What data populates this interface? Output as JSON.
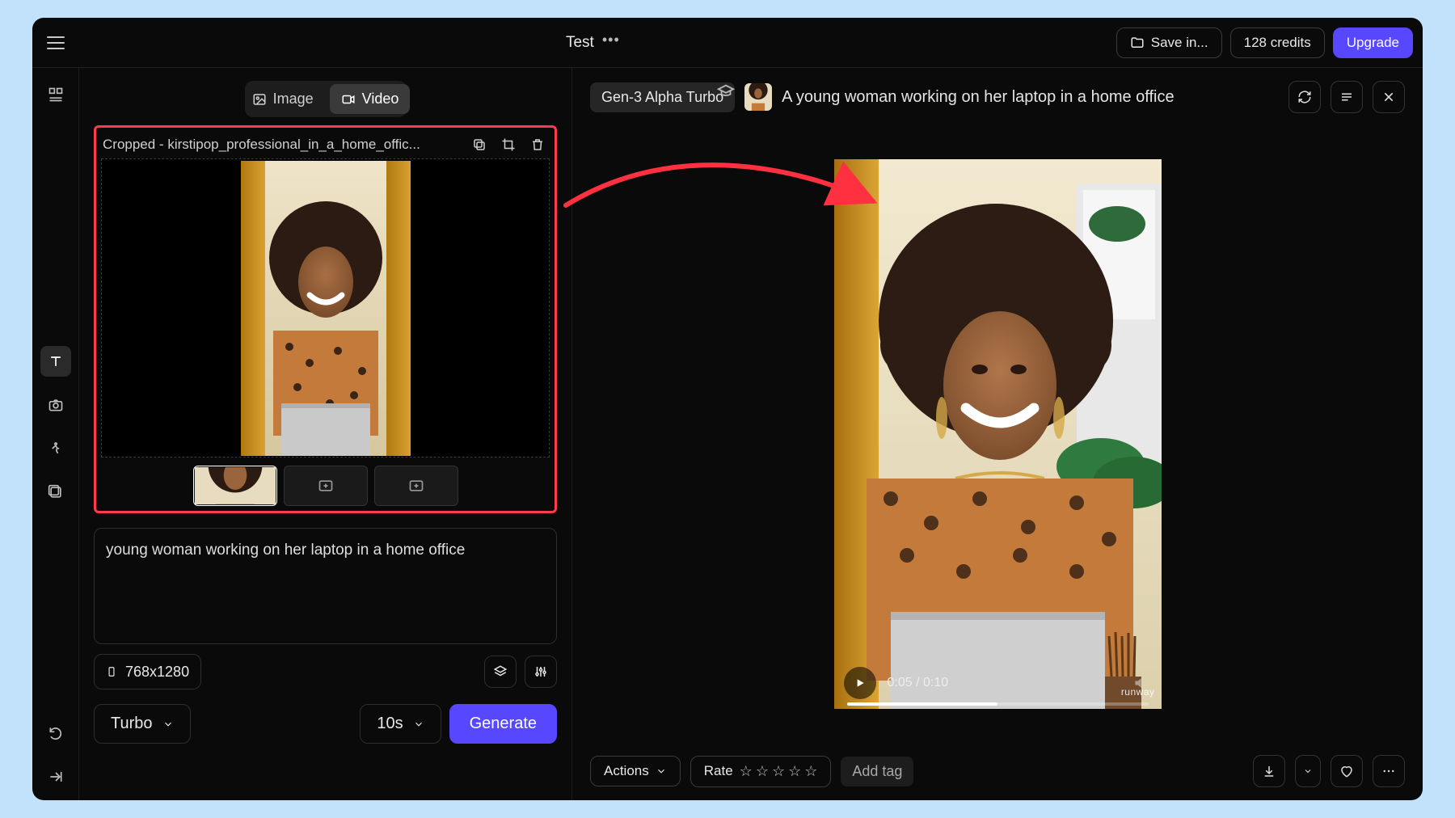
{
  "topbar": {
    "title": "Test",
    "save": "Save in...",
    "credits": "128 credits",
    "upgrade": "Upgrade"
  },
  "left_tools": {
    "icons": [
      "layout-icon",
      "text-icon",
      "camera-icon",
      "motion-icon",
      "aspect-icon",
      "undo-icon",
      "expand-icon"
    ]
  },
  "panel": {
    "tabs": {
      "image": "Image",
      "video": "Video"
    },
    "image_name": "Cropped - kirstipop_professional_in_a_home_offic...",
    "prompt": "young woman working on her laptop in a home office",
    "dimensions": "768x1280",
    "model": "Turbo",
    "duration": "10s",
    "generate": "Generate"
  },
  "preview": {
    "model_chip": "Gen-3 Alpha Turbo",
    "title": "A young woman working on her laptop in a home office",
    "time_current": "0:05",
    "time_total": "0:10",
    "watermark": "runway",
    "actions": "Actions",
    "rate": "Rate",
    "addtag": "Add tag"
  },
  "colors": {
    "highlight": "#ff3b4e",
    "accent": "#5748ff"
  }
}
